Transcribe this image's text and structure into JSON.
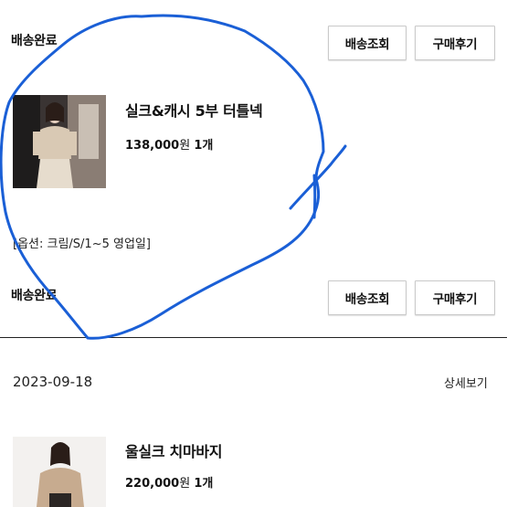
{
  "orders": [
    {
      "status": "배송완료",
      "buttons": {
        "track": "배송조회",
        "review": "구매후기"
      },
      "product": {
        "name": "실크&캐시 5부 터틀넥",
        "price": "138,000",
        "currency": "원",
        "quantity": "1개",
        "option": "[옵션: 크림/S/1~5 영업일]"
      },
      "footer_status": "배송완료",
      "footer_buttons": {
        "track": "배송조회",
        "review": "구매후기"
      }
    },
    {
      "date": "2023-09-18",
      "detail_link": "상세보기",
      "product": {
        "name": "울실크 치마바지",
        "price": "220,000",
        "currency": "원",
        "quantity": "1개"
      }
    }
  ],
  "colors": {
    "annotation_stroke": "#1a5fd6",
    "divider": "#222222"
  }
}
